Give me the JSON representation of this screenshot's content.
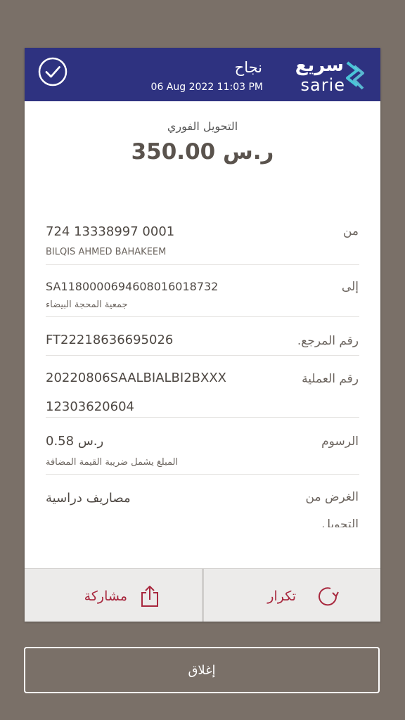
{
  "header": {
    "status": "نجاح",
    "datetime": "06 Aug 2022 11:03 PM",
    "logo_ar": "سريع",
    "logo_en": "sarie",
    "check_icon": "check-circle-icon",
    "logo_icon": "sarie-logo-icon"
  },
  "transfer": {
    "type": "التحويل الفوري",
    "amount": "350.00 ر.س"
  },
  "details": {
    "from": {
      "label": "من",
      "value": "724  13338997  0001",
      "sub": "BILQIS AHMED BAHAKEEM"
    },
    "to": {
      "label": "إلى",
      "value": "SA1180000694608016018732",
      "sub": "جمعية المحجة البيضاء"
    },
    "reference": {
      "label": "رقم المرجع.",
      "value": "FT22218636695026"
    },
    "transaction": {
      "label": "رقم العملية",
      "value": "20220806SAALBIALBI2BXXX",
      "value2": "12303620604"
    },
    "fees": {
      "label": "الرسوم",
      "value": "0.58 ر.س",
      "sub": "المبلغ يشمل ضريبة القيمة المضافة"
    },
    "purpose": {
      "label": "الغرض من",
      "label2": "التحويل",
      "value": "مصاريف دراسية"
    }
  },
  "footer": {
    "share_label": "مشاركة",
    "share_icon": "share-icon",
    "repeat_label": "تكرار",
    "repeat_icon": "repeat-icon"
  },
  "close_label": "إغلاق",
  "colors": {
    "header_bg": "#2e3280",
    "accent_red": "#a8283e",
    "page_bg": "#7a7068"
  }
}
